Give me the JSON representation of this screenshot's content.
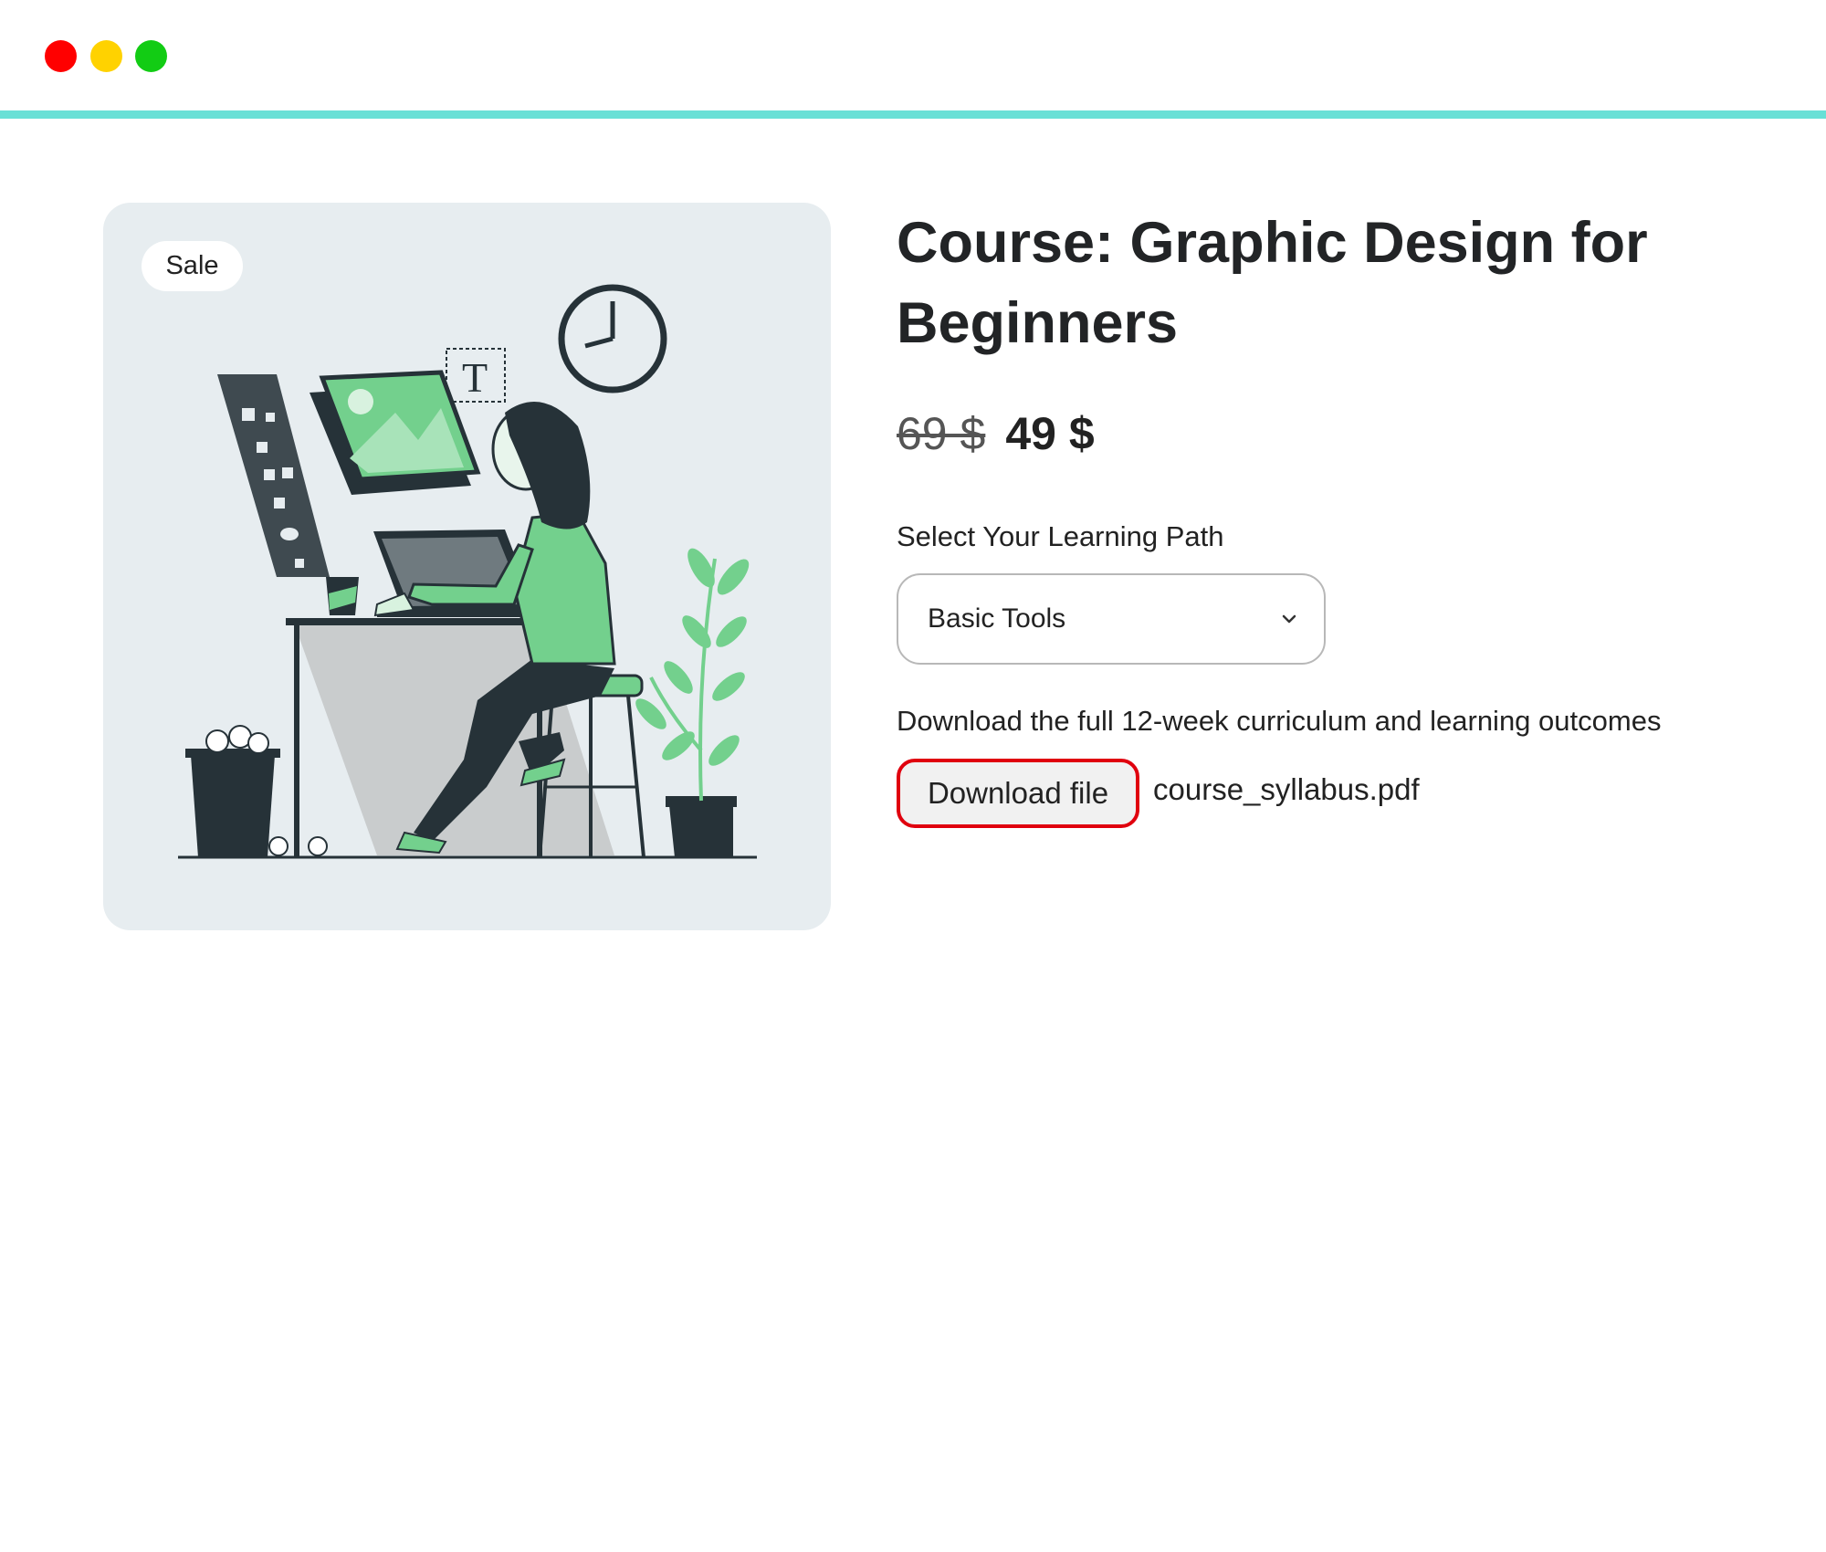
{
  "window": {
    "controls": [
      "close-dot",
      "minimize-dot",
      "maximize-dot"
    ],
    "colors": {
      "close": "#ff0000",
      "minimize": "#ffd200",
      "maximize": "#12cc14",
      "accent_line": "#69e0d6"
    }
  },
  "product": {
    "badge": "Sale",
    "title": "Course: Graphic Design for Beginners",
    "old_price": "69 $",
    "new_price": "49 $",
    "image_description_icon": "designer-illustration"
  },
  "learning_path": {
    "label": "Select Your Learning Path",
    "selected": "Basic Tools",
    "chevron_icon": "chevron-down-icon"
  },
  "download": {
    "description": "Download the full 12-week curriculum and learning outcomes",
    "button_label": "Download file",
    "file_name": "course_syllabus.pdf",
    "highlight_color": "#e0000e"
  },
  "colors": {
    "card_background": "#e7edf0",
    "illustration_green": "#73d08d",
    "illustration_dark": "#263238"
  }
}
